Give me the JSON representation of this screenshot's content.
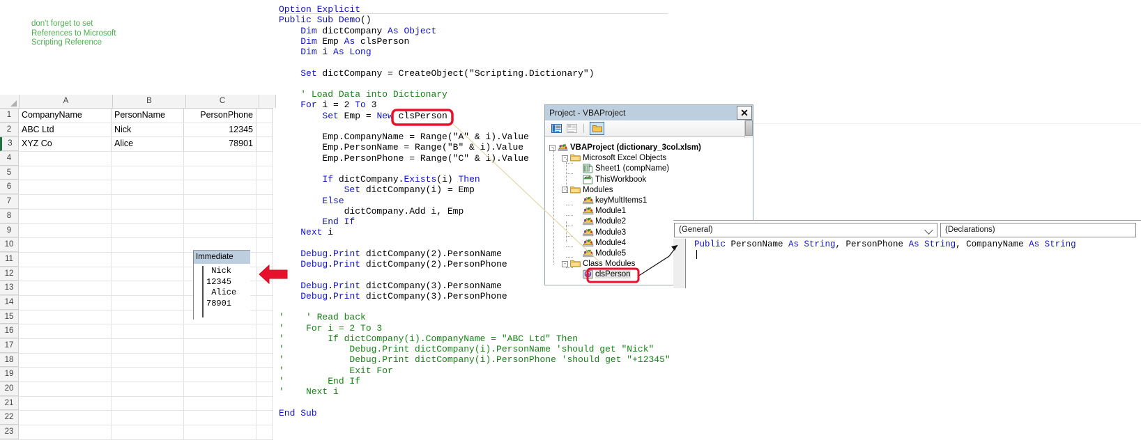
{
  "excel": {
    "note": "don't forget to set\nReferences to Microsoft\nScripting Reference",
    "note_color": "#4caf50",
    "columns": [
      "A",
      "B",
      "C"
    ],
    "headers": [
      "CompanyName",
      "PersonName",
      "PersonPhone"
    ],
    "rows": [
      {
        "num": "1",
        "a": "CompanyName",
        "b": "PersonName",
        "c": "PersonPhone"
      },
      {
        "num": "2",
        "a": "ABC Ltd",
        "b": "Nick",
        "c": "12345"
      },
      {
        "num": "3",
        "a": "XYZ Co",
        "b": "Alice",
        "c": "78901"
      }
    ],
    "empty_row_numbers": [
      "4",
      "5",
      "6",
      "7",
      "8",
      "9",
      "10",
      "11",
      "12",
      "13",
      "14",
      "15",
      "16",
      "17",
      "18",
      "19",
      "20",
      "21",
      "22",
      "23"
    ]
  },
  "code": {
    "lines": [
      [
        [
          "Option Explicit",
          "kw"
        ]
      ],
      [
        [
          "Public Sub Demo",
          "kw"
        ],
        [
          "()",
          "pl"
        ]
      ],
      [
        [
          "    ",
          "pl"
        ],
        [
          "Dim",
          "kw"
        ],
        [
          " dictCompany ",
          "pl"
        ],
        [
          "As Object",
          "kw"
        ]
      ],
      [
        [
          "    ",
          "pl"
        ],
        [
          "Dim",
          "kw"
        ],
        [
          " Emp ",
          "pl"
        ],
        [
          "As",
          "kw"
        ],
        [
          " clsPerson",
          "pl"
        ]
      ],
      [
        [
          "    ",
          "pl"
        ],
        [
          "Dim",
          "kw"
        ],
        [
          " i ",
          "pl"
        ],
        [
          "As Long",
          "kw"
        ]
      ],
      [
        [
          "",
          ""
        ]
      ],
      [
        [
          "    ",
          "pl"
        ],
        [
          "Set",
          "kw"
        ],
        [
          " dictCompany = CreateObject(",
          "pl"
        ],
        [
          "\"Scripting.Dictionary\"",
          "pl"
        ],
        [
          ")",
          "pl"
        ]
      ],
      [
        [
          "",
          ""
        ]
      ],
      [
        [
          "    ",
          "pl"
        ],
        [
          "' Load Data into Dictionary",
          "cm"
        ]
      ],
      [
        [
          "    ",
          "pl"
        ],
        [
          "For",
          "kw"
        ],
        [
          " i = 2 ",
          "pl"
        ],
        [
          "To",
          "kw"
        ],
        [
          " 3",
          "pl"
        ]
      ],
      [
        [
          "        ",
          "pl"
        ],
        [
          "Set",
          "kw"
        ],
        [
          " Emp = ",
          "pl"
        ],
        [
          "New",
          "kw"
        ],
        [
          " clsPerson",
          "pl"
        ]
      ],
      [
        [
          "",
          ""
        ]
      ],
      [
        [
          "        Emp.CompanyName = Range(\"A\" & i).Value",
          "pl"
        ]
      ],
      [
        [
          "        Emp.PersonName = Range(\"B\" & i).Value",
          "pl"
        ]
      ],
      [
        [
          "        Emp.PersonPhone = Range(\"C\" & i).Value",
          "pl"
        ]
      ],
      [
        [
          "",
          ""
        ]
      ],
      [
        [
          "        ",
          "pl"
        ],
        [
          "If",
          "kw"
        ],
        [
          " dictCompany.",
          "pl"
        ],
        [
          "Exists",
          "kw"
        ],
        [
          "(i) ",
          "pl"
        ],
        [
          "Then",
          "kw"
        ]
      ],
      [
        [
          "            ",
          "pl"
        ],
        [
          "Set",
          "kw"
        ],
        [
          " dictCompany(i) = Emp",
          "pl"
        ]
      ],
      [
        [
          "        ",
          "pl"
        ],
        [
          "Else",
          "kw"
        ]
      ],
      [
        [
          "            dictCompany.Add i, Emp",
          "pl"
        ]
      ],
      [
        [
          "        ",
          "pl"
        ],
        [
          "End If",
          "kw"
        ]
      ],
      [
        [
          "    ",
          "pl"
        ],
        [
          "Next",
          "kw"
        ],
        [
          " i",
          "pl"
        ]
      ],
      [
        [
          "",
          ""
        ]
      ],
      [
        [
          "    ",
          "pl"
        ],
        [
          "Debug",
          "kw"
        ],
        [
          ".",
          "pl"
        ],
        [
          "Print",
          "kw"
        ],
        [
          " dictCompany(2).PersonName",
          "pl"
        ]
      ],
      [
        [
          "    ",
          "pl"
        ],
        [
          "Debug",
          "kw"
        ],
        [
          ".",
          "pl"
        ],
        [
          "Print",
          "kw"
        ],
        [
          " dictCompany(2).PersonPhone",
          "pl"
        ]
      ],
      [
        [
          "",
          ""
        ]
      ],
      [
        [
          "    ",
          "pl"
        ],
        [
          "Debug",
          "kw"
        ],
        [
          ".",
          "pl"
        ],
        [
          "Print",
          "kw"
        ],
        [
          " dictCompany(3).PersonName",
          "pl"
        ]
      ],
      [
        [
          "    ",
          "pl"
        ],
        [
          "Debug",
          "kw"
        ],
        [
          ".",
          "pl"
        ],
        [
          "Print",
          "kw"
        ],
        [
          " dictCompany(3).PersonPhone",
          "pl"
        ]
      ],
      [
        [
          "",
          ""
        ]
      ],
      [
        [
          "'",
          "cm"
        ],
        [
          "    ' Read back",
          "cm"
        ]
      ],
      [
        [
          "'",
          "cm"
        ],
        [
          "    For i = 2 To 3",
          "cm"
        ]
      ],
      [
        [
          "'",
          "cm"
        ],
        [
          "        If dictCompany(i).CompanyName = \"ABC Ltd\" Then",
          "cm"
        ]
      ],
      [
        [
          "'",
          "cm"
        ],
        [
          "            Debug.Print dictCompany(i).PersonName 'should get \"Nick\"",
          "cm"
        ]
      ],
      [
        [
          "'",
          "cm"
        ],
        [
          "            Debug.Print dictCompany(i).PersonPhone 'should get \"+12345\"",
          "cm"
        ]
      ],
      [
        [
          "'",
          "cm"
        ],
        [
          "            Exit For",
          "cm"
        ]
      ],
      [
        [
          "'",
          "cm"
        ],
        [
          "        End If",
          "cm"
        ]
      ],
      [
        [
          "'",
          "cm"
        ],
        [
          "    Next i",
          "cm"
        ]
      ],
      [
        [
          "",
          ""
        ]
      ],
      [
        [
          "End Sub",
          "kw"
        ]
      ]
    ],
    "highlighted_token": "clsPerson",
    "highlight_color": "#e8112d"
  },
  "immediate": {
    "title": "Immediate",
    "output": " Nick\n12345\n Alice\n78901"
  },
  "project_explorer": {
    "title": "Project - VBAProject",
    "close_label": "✕",
    "toolbar_icons": [
      "view-code-icon",
      "view-object-icon",
      "toggle-folders-icon"
    ],
    "tree": [
      {
        "label": "VBAProject (dictionary_3col.xlsm)",
        "icon": "vbaproject-icon",
        "depth": 0,
        "toggle": "-",
        "bold": true
      },
      {
        "label": "Microsoft Excel Objects",
        "icon": "folder-icon",
        "depth": 1,
        "toggle": "-",
        "bold": false
      },
      {
        "label": "Sheet1 (compName)",
        "icon": "worksheet-icon",
        "depth": 2,
        "toggle": "",
        "bold": false
      },
      {
        "label": "ThisWorkbook",
        "icon": "workbook-icon",
        "depth": 2,
        "toggle": "",
        "bold": false
      },
      {
        "label": "Modules",
        "icon": "folder-icon",
        "depth": 1,
        "toggle": "-",
        "bold": false
      },
      {
        "label": "keyMultItems1",
        "icon": "module-icon",
        "depth": 2,
        "toggle": "",
        "bold": false
      },
      {
        "label": "Module1",
        "icon": "module-icon",
        "depth": 2,
        "toggle": "",
        "bold": false
      },
      {
        "label": "Module2",
        "icon": "module-icon",
        "depth": 2,
        "toggle": "",
        "bold": false
      },
      {
        "label": "Module3",
        "icon": "module-icon",
        "depth": 2,
        "toggle": "",
        "bold": false
      },
      {
        "label": "Module4",
        "icon": "module-icon",
        "depth": 2,
        "toggle": "",
        "bold": false
      },
      {
        "label": "Module5",
        "icon": "module-icon",
        "depth": 2,
        "toggle": "",
        "bold": false
      },
      {
        "label": "Class Modules",
        "icon": "folder-icon",
        "depth": 1,
        "toggle": "-",
        "bold": false
      },
      {
        "label": "clsPerson",
        "icon": "class-module-icon",
        "depth": 2,
        "toggle": "",
        "bold": false,
        "selected": true,
        "highlighted": true
      }
    ]
  },
  "class_pane": {
    "object_dropdown": "(General)",
    "procedure_dropdown": "(Declarations)",
    "code_line": [
      [
        "Public",
        "kw"
      ],
      [
        " PersonName ",
        "pl"
      ],
      [
        "As String",
        "kw"
      ],
      [
        ", PersonPhone ",
        "pl"
      ],
      [
        "As String",
        "kw"
      ],
      [
        ", CompanyName ",
        "pl"
      ],
      [
        "As String",
        "kw"
      ]
    ]
  },
  "colors": {
    "keyword": "#1111cc",
    "comment": "#178117",
    "plain": "#000000",
    "annotation_red": "#e8112d",
    "vba_title_bar": "#bdcede",
    "excel_header": "#f3f3f3",
    "excel_accent": "#217346"
  }
}
